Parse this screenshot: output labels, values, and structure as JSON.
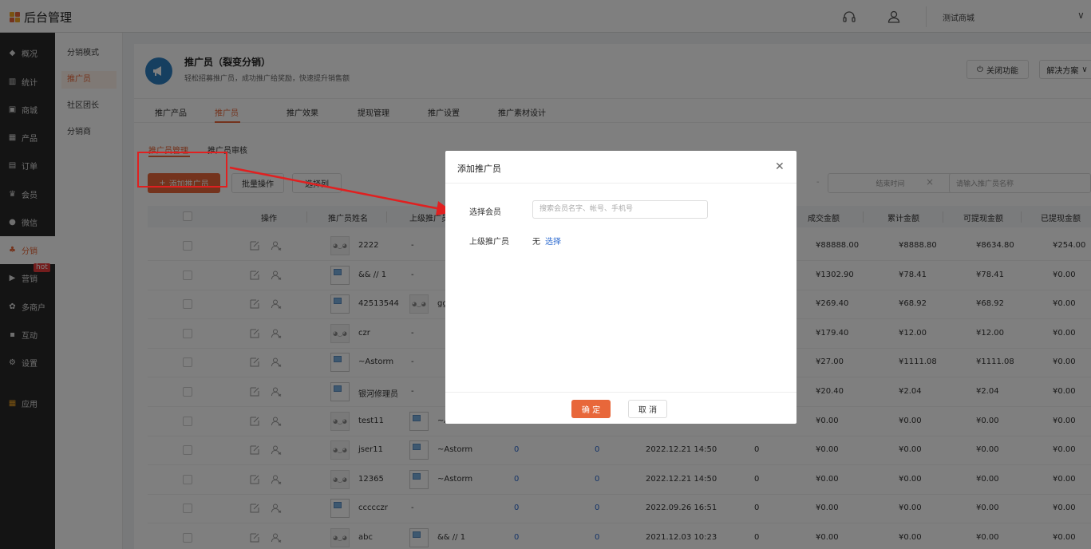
{
  "app": {
    "title": "后台管理",
    "shop_name": "测试商城"
  },
  "sidebar": {
    "items": [
      {
        "label": "概况",
        "icon": "layers-icon"
      },
      {
        "label": "统计",
        "icon": "chart-icon"
      },
      {
        "label": "商城",
        "icon": "shop-icon"
      },
      {
        "label": "产品",
        "icon": "grid-icon"
      },
      {
        "label": "订单",
        "icon": "order-icon"
      },
      {
        "label": "会员",
        "icon": "crown-icon"
      },
      {
        "label": "微信",
        "icon": "wechat-icon"
      },
      {
        "label": "分销",
        "icon": "share-icon"
      },
      {
        "label": "营销",
        "icon": "flag-icon"
      },
      {
        "label": "多商户",
        "icon": "merchant-icon"
      },
      {
        "label": "互动",
        "icon": "interact-icon"
      },
      {
        "label": "设置",
        "icon": "gear-icon"
      },
      {
        "label": "应用",
        "icon": "apps-icon"
      }
    ],
    "hot_badge": "hot",
    "active": "分销"
  },
  "submenu": {
    "items": [
      "分销模式",
      "推广员",
      "社区团长",
      "分销商"
    ],
    "active": "推广员"
  },
  "header": {
    "title": "推广员（裂变分销）",
    "desc": "轻松招募推广员，成功推广给奖励，快速提升销售额",
    "close_btn": "关闭功能",
    "solution_btn": "解决方案"
  },
  "tabs": [
    "推广产品",
    "推广员",
    "推广效果",
    "提现管理",
    "推广设置",
    "推广素材设计"
  ],
  "subtabs": [
    "推广员管理",
    "推广员审核"
  ],
  "toolbar": {
    "add_btn": "添加推广员",
    "batch_btn": "批量操作",
    "columns_btn": "选择列",
    "end_time_placeholder": "结束时间",
    "name_placeholder": "请输入推广员名称",
    "range_sep": "-",
    "clear": "×"
  },
  "table": {
    "columns": [
      "操作",
      "推广员姓名",
      "上级推广员",
      "成交金额",
      "累计金额",
      "可提现金额",
      "已提现金额"
    ],
    "rows": [
      {
        "name": "2222",
        "avatar": "robot",
        "parent": "-",
        "parent_avatar": "",
        "c1": "",
        "c2": "",
        "time": "",
        "c3": "",
        "deal": "¥88888.00",
        "total": "¥8888.80",
        "withdrawable": "¥8634.80",
        "withdrawn": "¥254.00"
      },
      {
        "name": "&& // 1",
        "avatar": "broken",
        "parent": "-",
        "parent_avatar": "",
        "c1": "",
        "c2": "",
        "time": "",
        "c3": "",
        "deal": "¥1302.90",
        "total": "¥78.41",
        "withdrawable": "¥78.41",
        "withdrawn": "¥0.00"
      },
      {
        "name": "42513544",
        "avatar": "broken",
        "parent": "ggkk",
        "parent_avatar": "robot",
        "c1": "",
        "c2": "",
        "time": "",
        "c3": "",
        "deal": "¥269.40",
        "total": "¥68.92",
        "withdrawable": "¥68.92",
        "withdrawn": "¥0.00"
      },
      {
        "name": "czr",
        "avatar": "robot",
        "parent": "-",
        "parent_avatar": "",
        "c1": "",
        "c2": "",
        "time": "",
        "c3": "",
        "deal": "¥179.40",
        "total": "¥12.00",
        "withdrawable": "¥12.00",
        "withdrawn": "¥0.00"
      },
      {
        "name": "~Astorm",
        "avatar": "broken",
        "parent": "-",
        "parent_avatar": "",
        "c1": "",
        "c2": "",
        "time": "",
        "c3": "",
        "deal": "¥27.00",
        "total": "¥1111.08",
        "withdrawable": "¥1111.08",
        "withdrawn": "¥0.00"
      },
      {
        "name": "银河修理员",
        "avatar": "broken",
        "parent": "-",
        "parent_avatar": "",
        "c1": "",
        "c2": "",
        "time": "",
        "c3": "",
        "deal": "¥20.40",
        "total": "¥2.04",
        "withdrawable": "¥2.04",
        "withdrawn": "¥0.00"
      },
      {
        "name": "test11",
        "avatar": "robot",
        "parent": "~Ast",
        "parent_avatar": "broken",
        "c1": "",
        "c2": "",
        "time": "",
        "c3": "",
        "deal": "¥0.00",
        "total": "¥0.00",
        "withdrawable": "¥0.00",
        "withdrawn": "¥0.00"
      },
      {
        "name": "jser11",
        "avatar": "robot",
        "parent": "~Astorm",
        "parent_avatar": "broken",
        "c1": "0",
        "c2": "0",
        "time": "2022.12.21 14:50",
        "c3": "0",
        "deal": "¥0.00",
        "total": "¥0.00",
        "withdrawable": "¥0.00",
        "withdrawn": "¥0.00"
      },
      {
        "name": "12365",
        "avatar": "robot",
        "parent": "~Astorm",
        "parent_avatar": "broken",
        "c1": "0",
        "c2": "0",
        "time": "2022.12.21 14:50",
        "c3": "0",
        "deal": "¥0.00",
        "total": "¥0.00",
        "withdrawable": "¥0.00",
        "withdrawn": "¥0.00"
      },
      {
        "name": "ccccczr",
        "avatar": "broken",
        "parent": "-",
        "parent_avatar": "",
        "c1": "0",
        "c2": "0",
        "time": "2022.09.26 16:51",
        "c3": "0",
        "deal": "¥0.00",
        "total": "¥0.00",
        "withdrawable": "¥0.00",
        "withdrawn": "¥0.00"
      },
      {
        "name": "abc",
        "avatar": "robot",
        "parent": "&& // 1",
        "parent_avatar": "broken",
        "c1": "0",
        "c2": "0",
        "time": "2021.12.03 10:23",
        "c3": "0",
        "deal": "¥0.00",
        "total": "¥0.00",
        "withdrawable": "¥0.00",
        "withdrawn": "¥0.00"
      }
    ]
  },
  "modal": {
    "title": "添加推广员",
    "member_label": "选择会员",
    "member_placeholder": "搜索会员名字、帐号、手机号",
    "parent_label": "上级推广员",
    "parent_value": "无",
    "parent_link": "选择",
    "ok_btn": "确 定",
    "cancel_btn": "取 消"
  },
  "colors": {
    "accent": "#e8673a",
    "link": "#2d6bd0",
    "annotation": "#e02020",
    "sidebar_bg": "#282828"
  }
}
